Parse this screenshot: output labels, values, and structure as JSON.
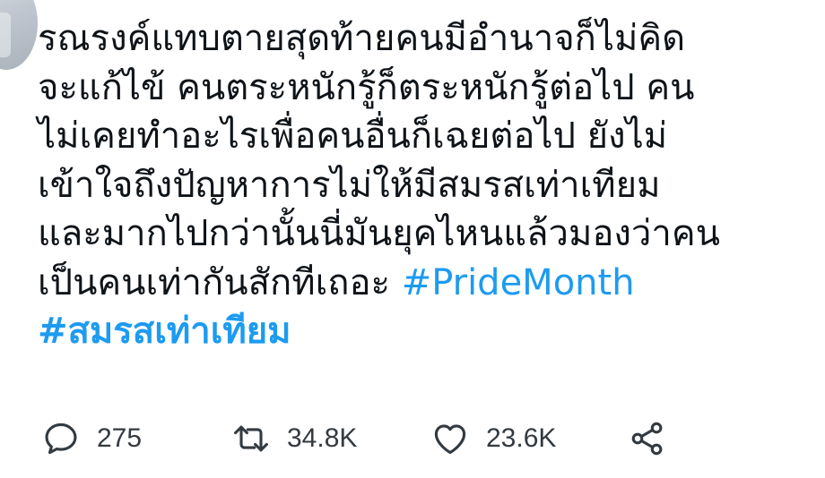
{
  "tweet": {
    "lines": [
      "รณรงค์แทบตายสุดท้ายคนมีอำนาจก็ไม่คิด",
      "จะแก้ไข้ คนตระหนักรู้ก็ตระหนักรู้ต่อไป คน",
      "ไม่เคยทำอะไรเพื่อคนอื่นก็เฉยต่อไป ยังไม่",
      "เข้าใจถึงปัญหาการไม่ให้มีสมรสเท่าเทียม",
      "และมากไปกว่านั้นนี่มันยุคไหนแล้วมองว่าคน"
    ],
    "last_line_text": "เป็นคนเท่ากันสักทีเถอะ ",
    "hashtag_1": "#PrideMonth",
    "hashtag_2": "#สมรสเท่าเทียม"
  },
  "actions": {
    "reply_count": "275",
    "retweet_count": "34.8K",
    "like_count": "23.6K",
    "reply_icon": "reply-icon",
    "retweet_icon": "retweet-icon",
    "like_icon": "heart-icon",
    "share_icon": "share-icon"
  },
  "colors": {
    "hashtag": "#1d9bf0",
    "text": "#0f1419",
    "icon": "#333a40"
  }
}
